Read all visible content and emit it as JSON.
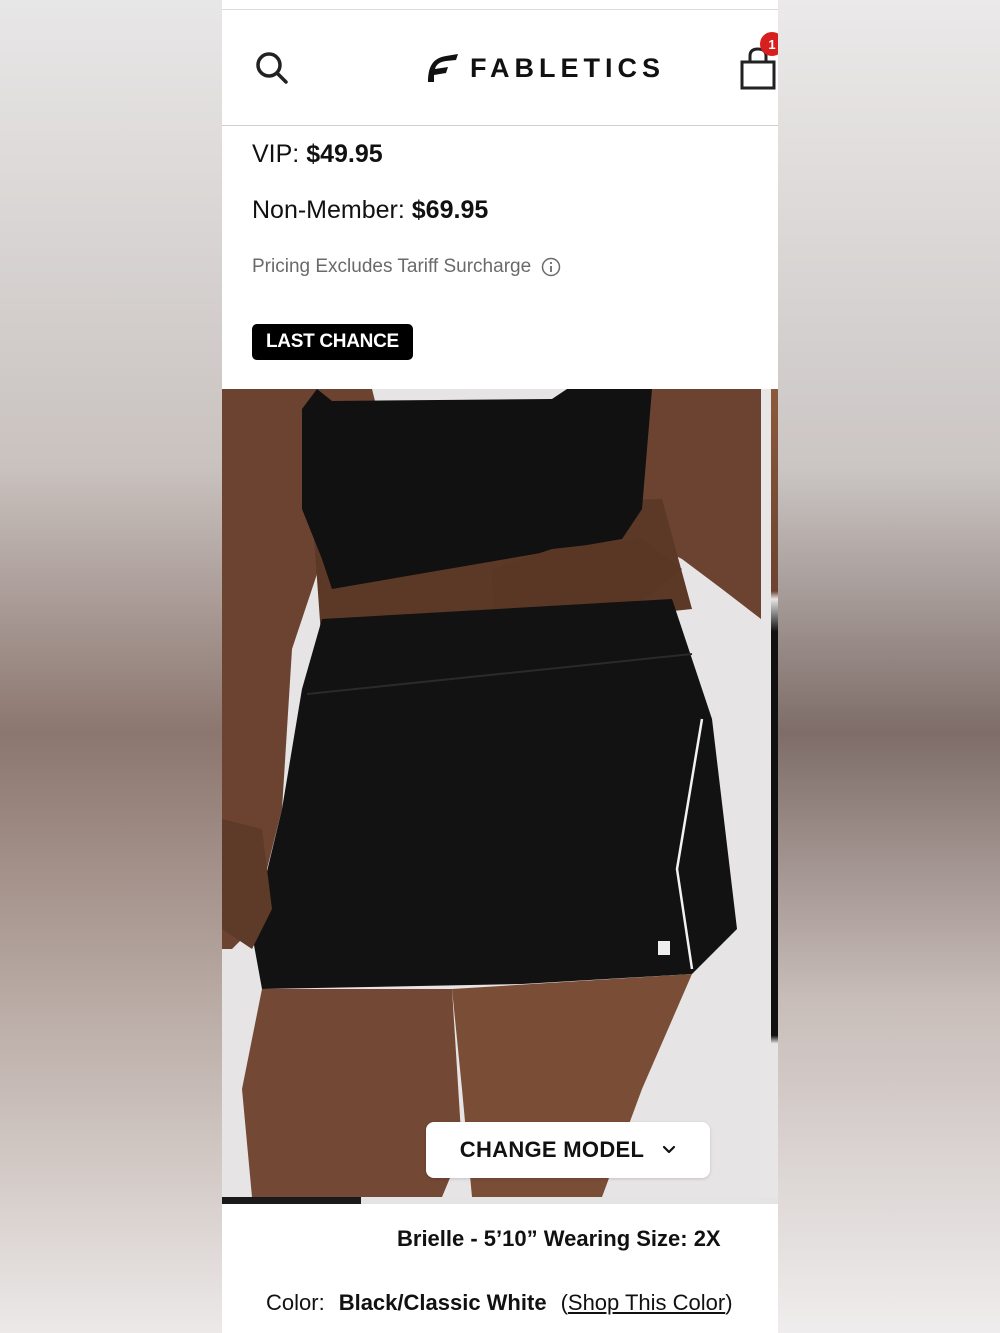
{
  "header": {
    "brand": "FABLETICS",
    "cart_count": "1"
  },
  "pricing": {
    "vip_label": "VIP:",
    "vip_price": "$49.95",
    "nonmember_label": "Non-Member:",
    "nonmember_price": "$69.95",
    "tariff_note": "Pricing Excludes Tariff Surcharge"
  },
  "badge": "LAST CHANCE",
  "gallery": {
    "change_model_label": "CHANGE MODEL",
    "progress": 0.25
  },
  "model_info": "Brielle - 5’10” Wearing Size: 2X",
  "color": {
    "label": "Color:",
    "value": "Black/Classic White",
    "open_paren": "(",
    "link": "Shop This Color",
    "close_paren": ")"
  },
  "icons": [
    "search-icon",
    "fabletics-logo-icon",
    "shopping-bag-icon",
    "info-icon",
    "chevron-down-icon"
  ],
  "colors": {
    "badge_bg": "#000000",
    "cart_badge": "#d6201f",
    "text": "#111111",
    "muted": "#6a6a6a"
  }
}
